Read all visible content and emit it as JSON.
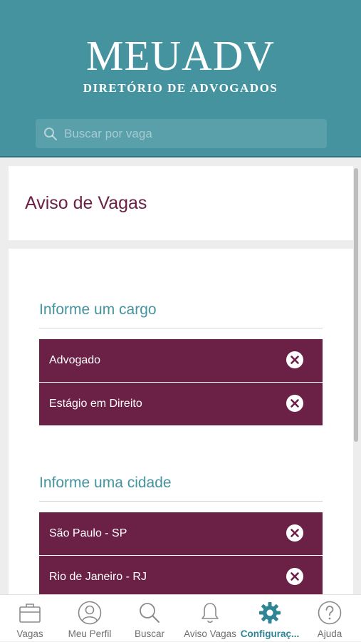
{
  "header": {
    "logo_title": "MEUADV",
    "logo_subtitle": "DIRETÓRIO DE ADVOGADOS",
    "search_placeholder": "Buscar por vaga"
  },
  "page": {
    "title": "Aviso de Vagas"
  },
  "sections": {
    "cargo": {
      "title": "Informe um cargo",
      "items": [
        {
          "label": "Advogado",
          "remove_icon": "close-circle-icon"
        },
        {
          "label": "Estágio em Direito",
          "remove_icon": "close-circle-icon"
        }
      ]
    },
    "cidade": {
      "title": "Informe uma cidade",
      "items": [
        {
          "label": "São Paulo - SP",
          "remove_icon": "close-circle-icon"
        },
        {
          "label": "Rio de Janeiro - RJ",
          "remove_icon": "close-circle-icon"
        }
      ]
    }
  },
  "bottom_nav": {
    "items": [
      {
        "label": "Vagas",
        "icon": "briefcase-icon",
        "active": false
      },
      {
        "label": "Meu Perfil",
        "icon": "user-icon",
        "active": false
      },
      {
        "label": "Buscar",
        "icon": "search-icon",
        "active": false
      },
      {
        "label": "Aviso Vagas",
        "icon": "bell-icon",
        "active": false
      },
      {
        "label": "Configuraç...",
        "icon": "gear-icon",
        "active": true
      },
      {
        "label": "Ajuda",
        "icon": "help-icon",
        "active": false
      }
    ]
  },
  "colors": {
    "header_bg": "#44939f",
    "accent_wine": "#6b2146",
    "accent_teal": "#44939f",
    "nav_active": "#2e8596",
    "nav_inactive": "#6f6f6f"
  }
}
